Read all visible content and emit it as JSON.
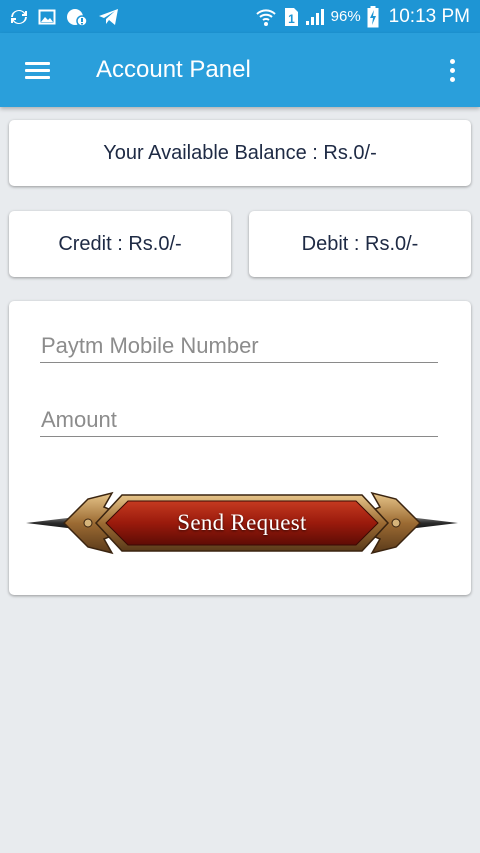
{
  "status_bar": {
    "battery_pct": "96%",
    "sim_slot": "1",
    "time": "10:13 PM",
    "icons": [
      "sync-icon",
      "image-icon",
      "notification-icon",
      "telegram-icon",
      "wifi-icon",
      "sim-icon",
      "signal-icon",
      "battery-icon"
    ]
  },
  "app_bar": {
    "title": "Account Panel",
    "menu_icon": "hamburger-menu-icon",
    "overflow_icon": "more-vert-icon",
    "color": "#2a9fdb"
  },
  "balance": {
    "label": "Your Available Balance : Rs.0/-"
  },
  "credit": {
    "label": "Credit : Rs.0/-"
  },
  "debit": {
    "label": "Debit : Rs.0/-"
  },
  "form": {
    "mobile_placeholder": "Paytm Mobile Number",
    "mobile_value": "",
    "amount_placeholder": "Amount",
    "amount_value": "",
    "send_label": "Send Request"
  },
  "colors": {
    "status_bar": "#1e95d4",
    "app_bar": "#2a9fdb",
    "background": "#e8ebee",
    "button_red": "#a11f10",
    "button_gold": "#b98a4a"
  }
}
